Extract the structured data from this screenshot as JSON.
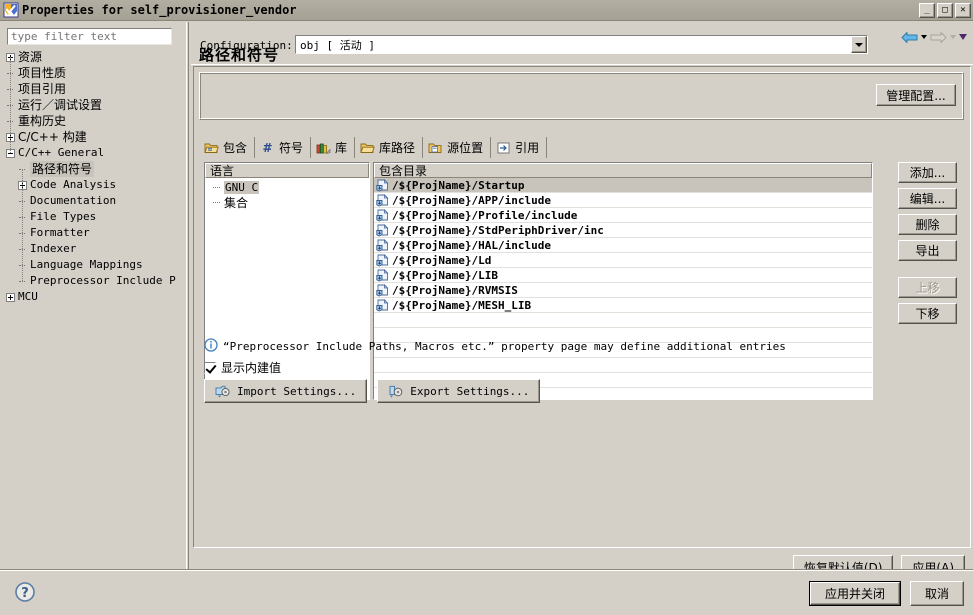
{
  "window": {
    "title": "Properties for self_provisioner_vendor",
    "icon": "eclipse-icon",
    "controls": [
      {
        "name": "minimize-button",
        "glyph": "_"
      },
      {
        "name": "maximize-button",
        "glyph": "□"
      },
      {
        "name": "close-button",
        "glyph": "✕"
      }
    ]
  },
  "sidebar": {
    "filter": {
      "value": "",
      "placeholder": "type filter text"
    },
    "items": [
      {
        "label": "资源",
        "indent": 1,
        "expander": "plus",
        "mono": false,
        "selected": false
      },
      {
        "label": "项目性质",
        "indent": 1,
        "expander": "dash",
        "mono": false,
        "selected": false
      },
      {
        "label": "项目引用",
        "indent": 1,
        "expander": "dash",
        "mono": false,
        "selected": false
      },
      {
        "label": "运行／调试设置",
        "indent": 1,
        "expander": "dash",
        "mono": false,
        "selected": false
      },
      {
        "label": "重构历史",
        "indent": 1,
        "expander": "dash",
        "mono": false,
        "selected": false
      },
      {
        "label": "C/C++ 构建",
        "indent": 1,
        "expander": "plus",
        "mono": false,
        "selected": false
      },
      {
        "label": "C/C++ General",
        "indent": 1,
        "expander": "minus",
        "mono": true,
        "selected": false
      },
      {
        "label": "路径和符号",
        "indent": 2,
        "expander": "dash",
        "mono": false,
        "selected": true
      },
      {
        "label": "Code Analysis",
        "indent": 2,
        "expander": "plus",
        "mono": true,
        "selected": false
      },
      {
        "label": "Documentation",
        "indent": 2,
        "expander": "dash",
        "mono": true,
        "selected": false
      },
      {
        "label": "File Types",
        "indent": 2,
        "expander": "dash",
        "mono": true,
        "selected": false
      },
      {
        "label": "Formatter",
        "indent": 2,
        "expander": "dash",
        "mono": true,
        "selected": false
      },
      {
        "label": "Indexer",
        "indent": 2,
        "expander": "dash",
        "mono": true,
        "selected": false
      },
      {
        "label": "Language Mappings",
        "indent": 2,
        "expander": "dash",
        "mono": true,
        "selected": false
      },
      {
        "label": "Preprocessor Include P",
        "indent": 2,
        "expander": "dash",
        "mono": true,
        "selected": false
      },
      {
        "label": "MCU",
        "indent": 1,
        "expander": "plus",
        "mono": true,
        "selected": false
      }
    ]
  },
  "page": {
    "title": "路径和符号",
    "nav": {
      "back_icon": "back-arrow-icon",
      "back_caret_icon": "chevron-down-icon",
      "forward_icon": "forward-arrow-icon",
      "forward_caret_icon": "chevron-down-icon",
      "menu_caret_icon": "chevron-down-icon"
    },
    "configuration": {
      "label": "Configuration:",
      "value": "obj  [ 活动 ]",
      "manage_button": "管理配置..."
    },
    "tabs": [
      {
        "label": "包含",
        "icon": "include-folder-icon",
        "active": true
      },
      {
        "label": "符号",
        "icon": "hash-symbol-icon",
        "active": false
      },
      {
        "label": "库",
        "icon": "library-books-icon",
        "active": false
      },
      {
        "label": "库路径",
        "icon": "library-path-folder-icon",
        "active": false
      },
      {
        "label": "源位置",
        "icon": "source-location-folder-icon",
        "active": false
      },
      {
        "label": "引用",
        "icon": "reference-arrow-icon",
        "active": false
      }
    ],
    "language_panel": {
      "header": "语言",
      "items": [
        {
          "label": "GNU C",
          "mono": true,
          "selected": true
        },
        {
          "label": "集合",
          "mono": false,
          "selected": false
        }
      ]
    },
    "directory_panel": {
      "header": "包含目录",
      "entries": [
        {
          "path": "/${ProjName}/Startup",
          "selected": true
        },
        {
          "path": "/${ProjName}/APP/include",
          "selected": false
        },
        {
          "path": "/${ProjName}/Profile/include",
          "selected": false
        },
        {
          "path": "/${ProjName}/StdPeriphDriver/inc",
          "selected": false
        },
        {
          "path": "/${ProjName}/HAL/include",
          "selected": false
        },
        {
          "path": "/${ProjName}/Ld",
          "selected": false
        },
        {
          "path": "/${ProjName}/LIB",
          "selected": false
        },
        {
          "path": "/${ProjName}/RVMSIS",
          "selected": false
        },
        {
          "path": "/${ProjName}/MESH_LIB",
          "selected": false
        }
      ]
    },
    "action_buttons": [
      {
        "label": "添加...",
        "name": "add-button",
        "disabled": false
      },
      {
        "label": "编辑...",
        "name": "edit-button",
        "disabled": false
      },
      {
        "label": "删除",
        "name": "delete-button",
        "disabled": false
      },
      {
        "label": "导出",
        "name": "export-button",
        "disabled": false
      },
      {
        "label": "上移",
        "name": "move-up-button",
        "disabled": true
      },
      {
        "label": "下移",
        "name": "move-down-button",
        "disabled": false
      }
    ],
    "info_note": {
      "icon": "info-icon",
      "text": "“Preprocessor Include Paths, Macros etc.” property page may define additional entries"
    },
    "show_builtin": {
      "label": "显示内建值",
      "checked": true
    },
    "import_button": {
      "label": "Import Settings...",
      "icon": "import-icon"
    },
    "export_button": {
      "label": "Export Settings...",
      "icon": "export-icon"
    },
    "restore_defaults_button": "恢复默认值(D)",
    "apply_button": "应用(A)"
  },
  "footer": {
    "help_icon": "help-question-icon",
    "apply_and_close_button": "应用并关闭",
    "cancel_button": "取消"
  },
  "colors": {
    "face": "#d4d0c8",
    "titlebar": "#aaa699",
    "selection": "#c8c4bc",
    "accent_blue": "#3f7fbf"
  }
}
